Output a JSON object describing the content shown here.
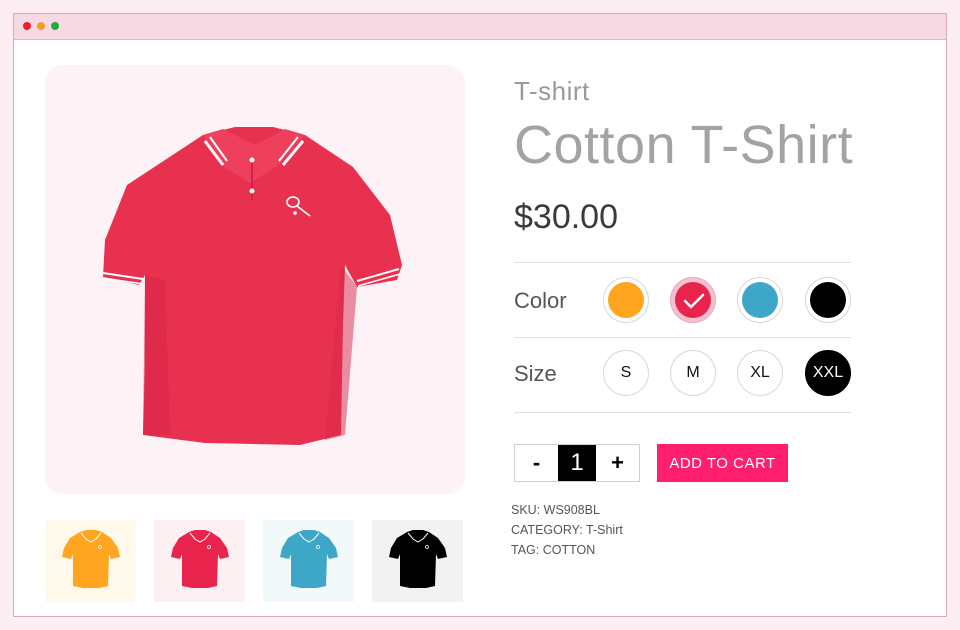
{
  "product": {
    "subtitle": "T-shirt",
    "title": "Cotton T-Shirt",
    "price": "$30.00"
  },
  "options": {
    "color_label": "Color",
    "size_label": "Size",
    "colors": [
      {
        "name": "orange",
        "hex": "#FFA51F"
      },
      {
        "name": "pink-red",
        "hex": "#E8244C",
        "selected": true
      },
      {
        "name": "blue",
        "hex": "#3EA6C6"
      },
      {
        "name": "black",
        "hex": "#000000"
      }
    ],
    "sizes": [
      {
        "label": "S"
      },
      {
        "label": "M"
      },
      {
        "label": "XL"
      },
      {
        "label": "XXL",
        "selected": true
      }
    ]
  },
  "cart": {
    "minus": "-",
    "quantity": "1",
    "plus": "+",
    "add_to_cart": "ADD TO CART"
  },
  "meta": {
    "sku": "SKU: WS908BL",
    "category": "CATEGORY: T-Shirt",
    "tag": "TAG: COTTON"
  },
  "colors": {
    "accent": "#FF1F6E",
    "window_bar": "#F7D9E3",
    "main_image_bg": "#FDF3F6"
  },
  "icons": [
    "window-close-dot",
    "window-minimize-dot",
    "window-maximize-dot",
    "check-icon",
    "tennis-racket-logo-icon"
  ]
}
